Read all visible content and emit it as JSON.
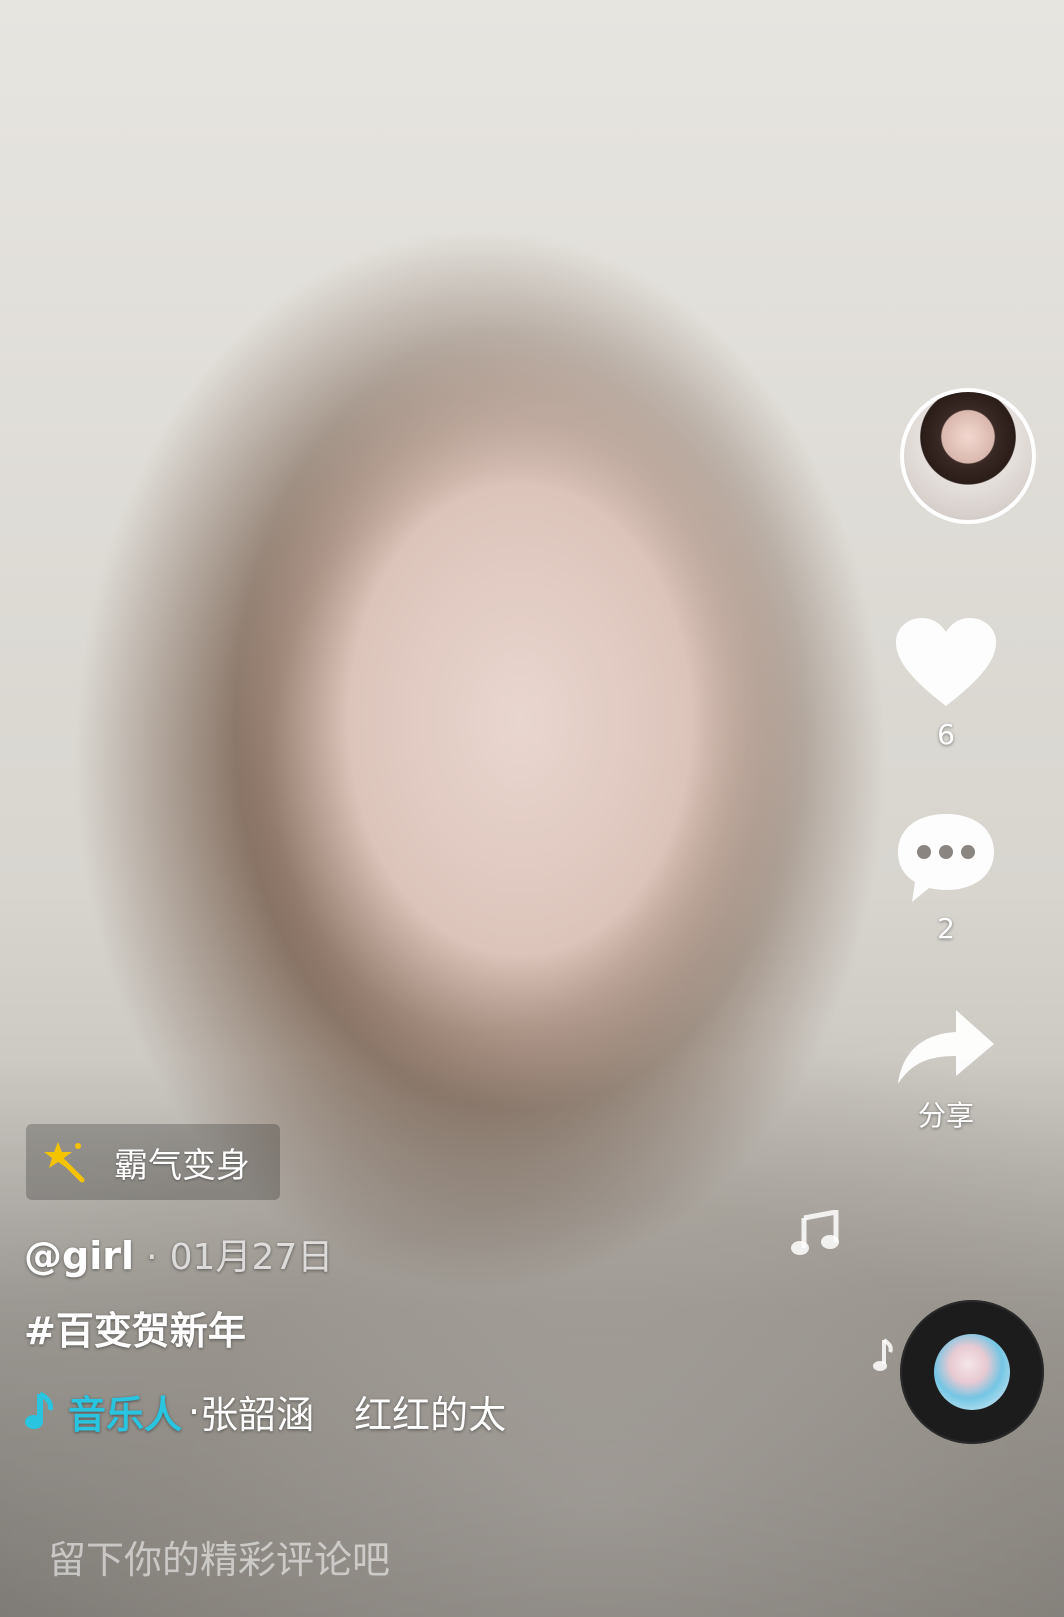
{
  "effect": {
    "icon": "magic-wand-icon",
    "label": "霸气变身"
  },
  "post": {
    "username": "@girl",
    "separator": "·",
    "date": "01月27日",
    "hashtag": "#百变贺新年"
  },
  "music": {
    "icon": "music-note-icon",
    "name": "音乐人",
    "separator": "·",
    "artist": "张韶涵",
    "song": "红红的太"
  },
  "actions": {
    "like_count": "6",
    "comment_count": "2",
    "share_label": "分享"
  },
  "comment_input": {
    "placeholder": "留下你的精彩评论吧"
  },
  "colors": {
    "music_accent": "#29c4e0",
    "effect_star": "#f5c400"
  }
}
